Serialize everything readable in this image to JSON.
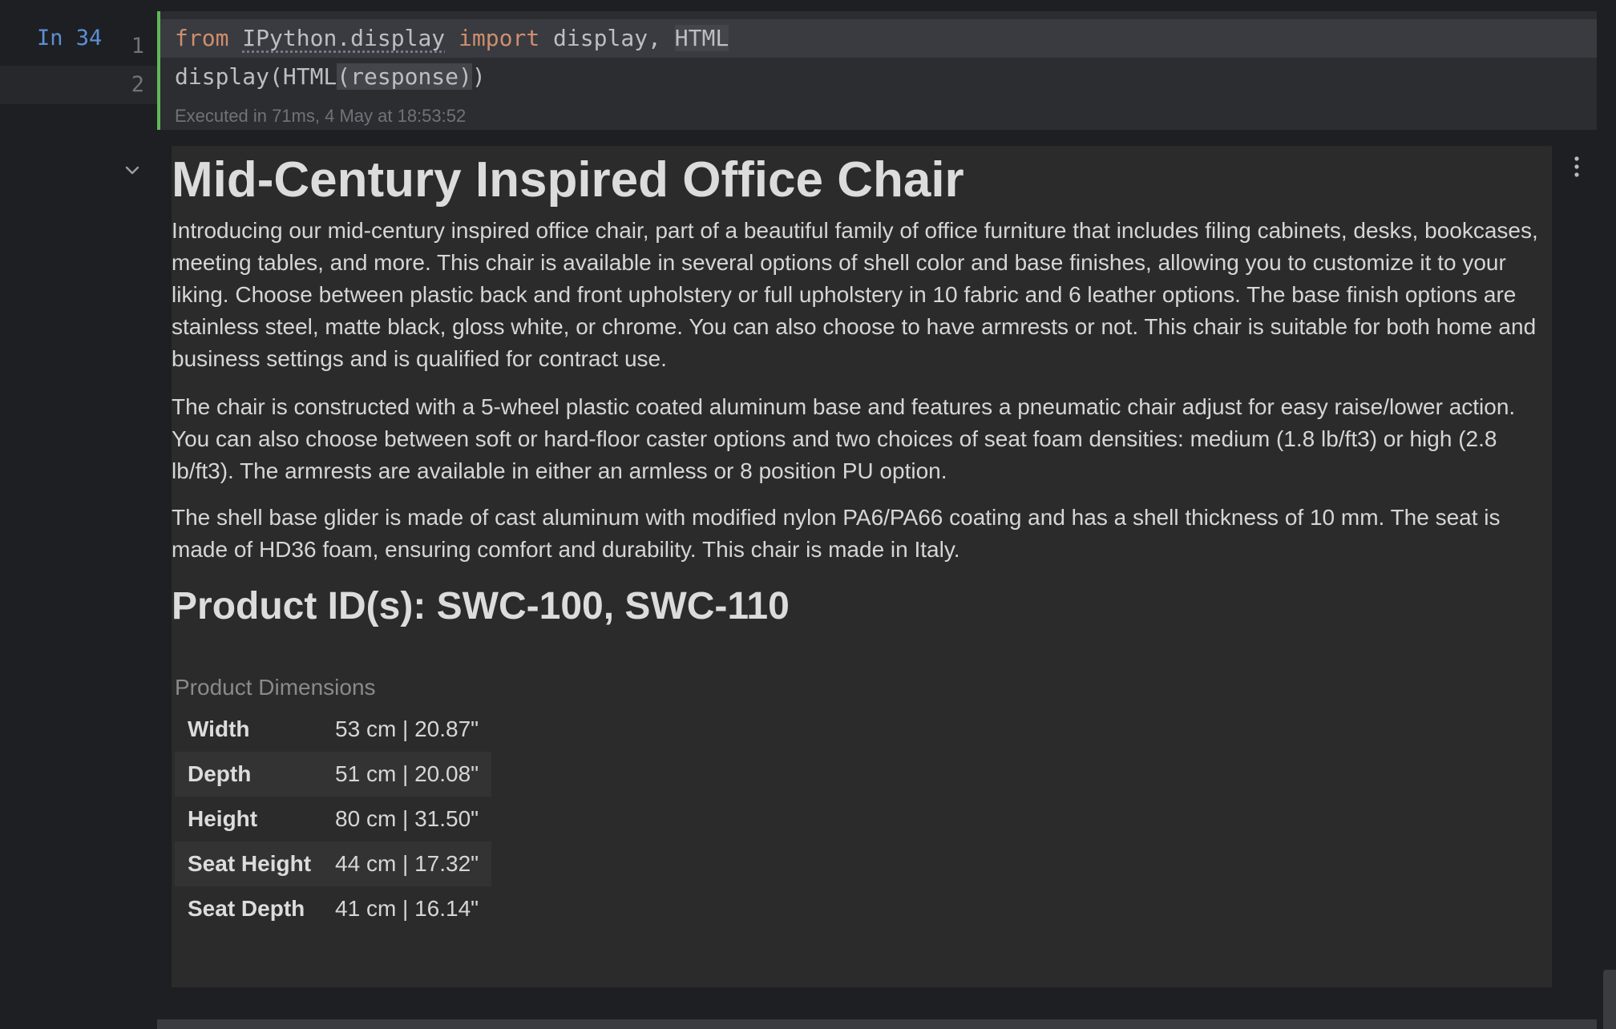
{
  "cell": {
    "prompt": "In 34",
    "line_numbers": [
      "1",
      "2"
    ],
    "line1": {
      "kw_from": "from",
      "module": "IPython.display",
      "kw_import": "import",
      "names_a": "display, ",
      "names_b": "HTML"
    },
    "line2": {
      "part_a": "display(HTML",
      "part_b": "(response)",
      "part_c": ")"
    },
    "exec_info": "Executed in 71ms, 4 May at 18:53:52"
  },
  "output": {
    "title": "Mid-Century Inspired Office Chair",
    "paragraphs": [
      "Introducing our mid-century inspired office chair, part of a beautiful family of office furniture that includes filing cabinets, desks, bookcases, meeting tables, and more. This chair is available in several options of shell color and base finishes, allowing you to customize it to your liking. Choose between plastic back and front upholstery or full upholstery in 10 fabric and 6 leather options. The base finish options are stainless steel, matte black, gloss white, or chrome. You can also choose to have armrests or not. This chair is suitable for both home and business settings and is qualified for contract use.",
      "The chair is constructed with a 5-wheel plastic coated aluminum base and features a pneumatic chair adjust for easy raise/lower action. You can also choose between soft or hard-floor caster options and two choices of seat foam densities: medium (1.8 lb/ft3) or high (2.8 lb/ft3). The armrests are available in either an armless or 8 position PU option.",
      "The shell base glider is made of cast aluminum with modified nylon PA6/PA66 coating and has a shell thickness of 10 mm. The seat is made of HD36 foam, ensuring comfort and durability. This chair is made in Italy."
    ],
    "subtitle": "Product ID(s): SWC-100, SWC-110",
    "table_caption": "Product Dimensions",
    "dimensions": [
      {
        "label": "Width",
        "value": "53 cm | 20.87\""
      },
      {
        "label": "Depth",
        "value": "51 cm | 20.08\""
      },
      {
        "label": "Height",
        "value": "80 cm | 31.50\""
      },
      {
        "label": "Seat Height",
        "value": "44 cm | 17.32\""
      },
      {
        "label": "Seat Depth",
        "value": "41 cm | 16.14\""
      }
    ]
  },
  "icons": {
    "collapse": "chevron-down-icon",
    "menu": "more-vertical-icon"
  },
  "colors": {
    "executed_marker": "#5fb85a",
    "keyword": "#cf8e6d",
    "prompt": "#5c8fd6"
  }
}
